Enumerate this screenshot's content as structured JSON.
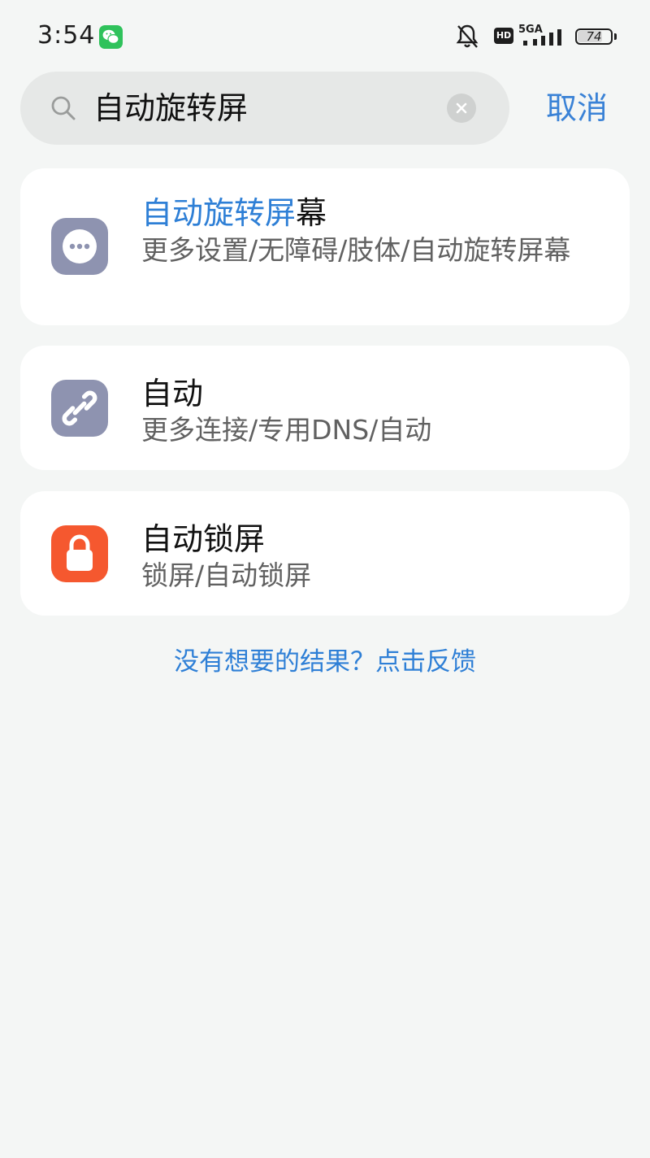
{
  "status_bar": {
    "time": "3:54",
    "hd": "HD",
    "network": "5GA",
    "battery_percent": 74,
    "battery_text": "74"
  },
  "search": {
    "query": "自动旋转屏",
    "cancel_label": "取消"
  },
  "results": [
    {
      "title_highlight": "自动旋转屏",
      "title_rest": "幕",
      "subtitle": "更多设置/无障碍/肢体/自动旋转屏幕",
      "icon": "more-dots-icon",
      "icon_color": "#8e93b0"
    },
    {
      "title_highlight": "",
      "title_rest": "自动",
      "subtitle": "更多连接/专用DNS/自动",
      "icon": "link-icon",
      "icon_color": "#8e93b0"
    },
    {
      "title_highlight": "",
      "title_rest": "自动锁屏",
      "subtitle": "锁屏/自动锁屏",
      "icon": "lock-icon",
      "icon_color": "#f5582f"
    }
  ],
  "feedback": {
    "label": "没有想要的结果？点击反馈"
  },
  "colors": {
    "accent": "#2e7fd6",
    "background": "#f4f6f5",
    "card": "#ffffff"
  }
}
